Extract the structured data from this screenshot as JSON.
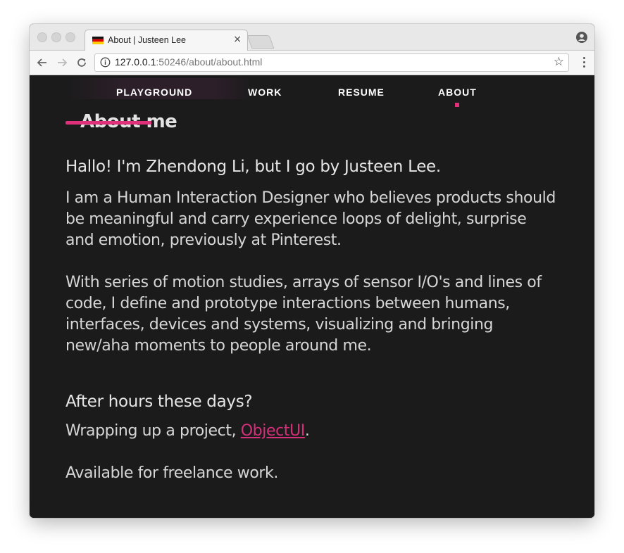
{
  "browser": {
    "tab_title": "About | Justeen Lee",
    "tab_close": "×",
    "url_host": "127.0.0.1",
    "url_rest": ":50246/about/about.html",
    "icons": {
      "favicon": "germany-flag-icon",
      "back": "back-arrow-icon",
      "forward": "forward-arrow-icon",
      "reload": "reload-icon",
      "info": "info-icon",
      "bookmark": "star-icon",
      "menu": "vertical-dots-icon",
      "profile": "profile-icon"
    }
  },
  "nav": {
    "items": [
      {
        "label": "PLAYGROUND"
      },
      {
        "label": "WORK"
      },
      {
        "label": "RESUME"
      },
      {
        "label": "ABOUT",
        "active": true
      }
    ],
    "accent_color": "#e0307a"
  },
  "content": {
    "section_title": "About me",
    "greeting": "Hallo! I'm Zhendong Li, but I go by Justeen Lee.",
    "paragraph_1": "I am a Human Interaction Designer who believes products should be meaningful and carry experience loops of delight, surprise and emotion, previously at Pinterest.",
    "paragraph_2": "With series of motion studies, arrays of sensor I/O's and lines of code, I define and prototype interactions between humans, interfaces, devices and systems, visualizing and bringing new/aha moments to people around me.",
    "after_hours_heading": "After hours these days?",
    "wrapping_prefix": "Wrapping up a project, ",
    "project_link": "ObjectUI",
    "wrapping_suffix": ".",
    "freelance": "Available for freelance work."
  },
  "colors": {
    "background": "#1c1b1c",
    "text": "#d6d6d6",
    "link": "#d4307a"
  }
}
